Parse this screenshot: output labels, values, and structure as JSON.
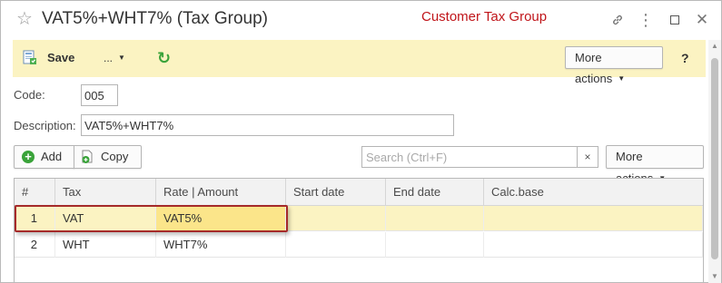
{
  "window": {
    "title": "VAT5%+WHT7% (Tax Group)",
    "annotation": "Customer Tax Group",
    "star_icon": "☆",
    "link_icon": "🔗",
    "menu_icon": "⋮",
    "close_icon": "✕"
  },
  "toolbar": {
    "save_label": "Save",
    "dots_label": "...",
    "refresh_icon": "↻",
    "more_actions_label": "More actions",
    "help_label": "?"
  },
  "form": {
    "code_label": "Code:",
    "code_value": "005",
    "description_label": "Description:",
    "description_value": "VAT5%+WHT7%"
  },
  "table_toolbar": {
    "add_label": "Add",
    "copy_label": "Copy",
    "search_placeholder": "Search (Ctrl+F)",
    "search_value": "",
    "clear_icon": "×",
    "more_actions_label": "More actions"
  },
  "table": {
    "columns": [
      "#",
      "Tax",
      "Rate | Amount",
      "Start date",
      "End date",
      "Calc.base"
    ],
    "rows": [
      {
        "num": "1",
        "tax": "VAT",
        "rate": "VAT5%",
        "start": "",
        "end": "",
        "calc_base": "",
        "selected": true
      },
      {
        "num": "2",
        "tax": "WHT",
        "rate": "WHT7%",
        "start": "",
        "end": "",
        "calc_base": "",
        "selected": false
      }
    ]
  },
  "colors": {
    "annotation": "#c0151a",
    "toolbar_bg": "#fbf3c2",
    "selected_row": "#fbf3c2",
    "active_cell": "#fbe58a",
    "highlight_border": "#a52a2a",
    "add_green": "#3aa33a"
  },
  "icons": [
    "star-icon",
    "link-icon",
    "menu-icon",
    "maximize-icon",
    "close-icon",
    "save-icon",
    "refresh-icon",
    "add-icon",
    "copy-icon",
    "caret-down-icon"
  ]
}
